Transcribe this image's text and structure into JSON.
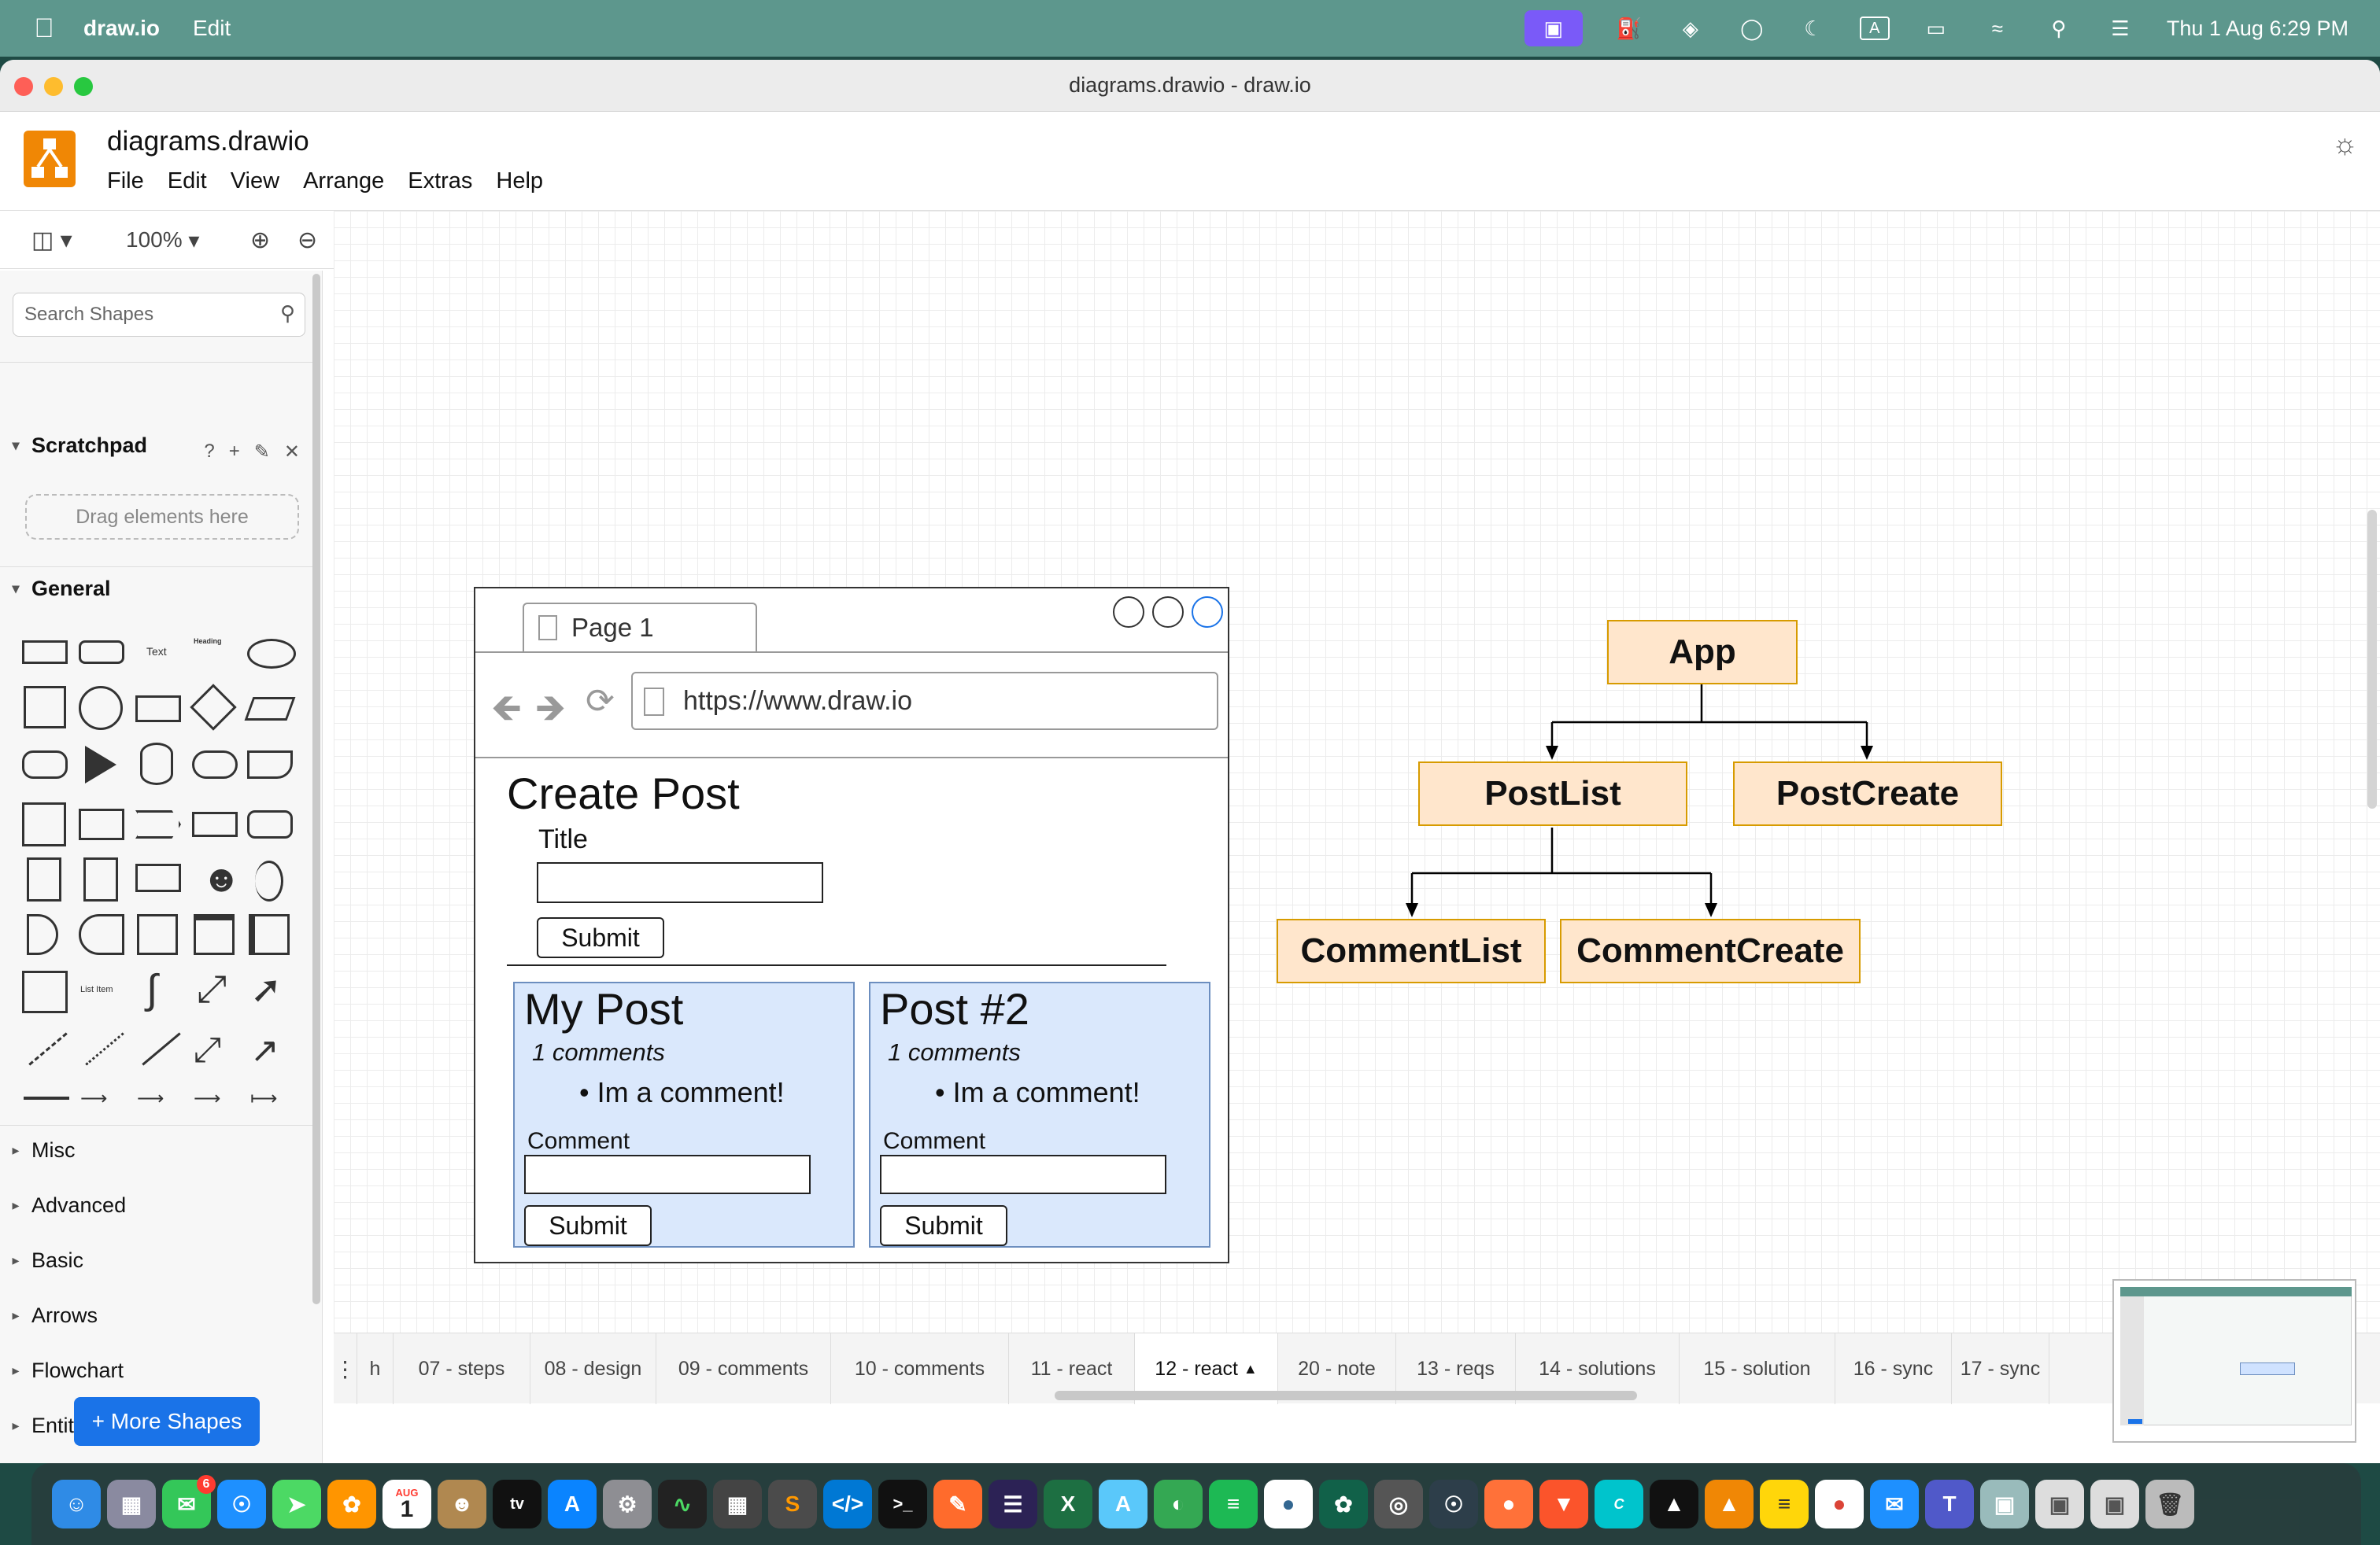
{
  "menubar": {
    "app": "draw.io",
    "edit": "Edit",
    "clock": "Thu 1 Aug  6:29 PM"
  },
  "window": {
    "title": "diagrams.drawio - draw.io"
  },
  "header": {
    "doc_title": "diagrams.drawio",
    "menus": [
      "File",
      "Edit",
      "View",
      "Arrange",
      "Extras",
      "Help"
    ]
  },
  "toolbar": {
    "zoom": "100%"
  },
  "sidebar": {
    "search_placeholder": "Search Shapes",
    "scratchpad": "Scratchpad",
    "scratchpad_help": "?",
    "dropzone": "Drag elements here",
    "general": "General",
    "sections": [
      "Misc",
      "Advanced",
      "Basic",
      "Arrows",
      "Flowchart",
      "Entity Relation"
    ],
    "more_shapes": "+ More Shapes",
    "shape_text": "Text",
    "shape_heading": "Heading",
    "shape_list_item": "List Item"
  },
  "mockup": {
    "tab": "Page 1",
    "url": "https://www.draw.io",
    "heading": "Create Post",
    "title_label": "Title",
    "submit": "Submit",
    "cards": [
      {
        "title": "My Post",
        "count": "1 comments",
        "comment": "Im a comment!",
        "label": "Comment",
        "submit": "Submit"
      },
      {
        "title": "Post #2",
        "count": "1 comments",
        "comment": "Im a comment!",
        "label": "Comment",
        "submit": "Submit"
      }
    ]
  },
  "tree": {
    "app": "App",
    "postlist": "PostList",
    "postcreate": "PostCreate",
    "commentlist": "CommentList",
    "commentcreate": "CommentCreate"
  },
  "page_tabs": [
    "h",
    "07 - steps",
    "08 - design",
    "09 - comments",
    "10 - comments",
    "11 - react",
    "12 - react",
    "20 - note",
    "13 - reqs",
    "14 - solutions",
    "15 - solution",
    "16 - sync",
    "17 - sync"
  ],
  "active_tab": "12 - react",
  "dock_badges": {
    "messages": "6",
    "calendar_month": "AUG",
    "calendar_day": "1"
  },
  "colors": {
    "menubar": "#5d978d",
    "tree_fill": "#ffe6cc",
    "tree_stroke": "#d79b00",
    "card_fill": "#dae8fc",
    "card_stroke": "#6c8ebf",
    "accent": "#1a73e8",
    "logo": "#f08705"
  }
}
